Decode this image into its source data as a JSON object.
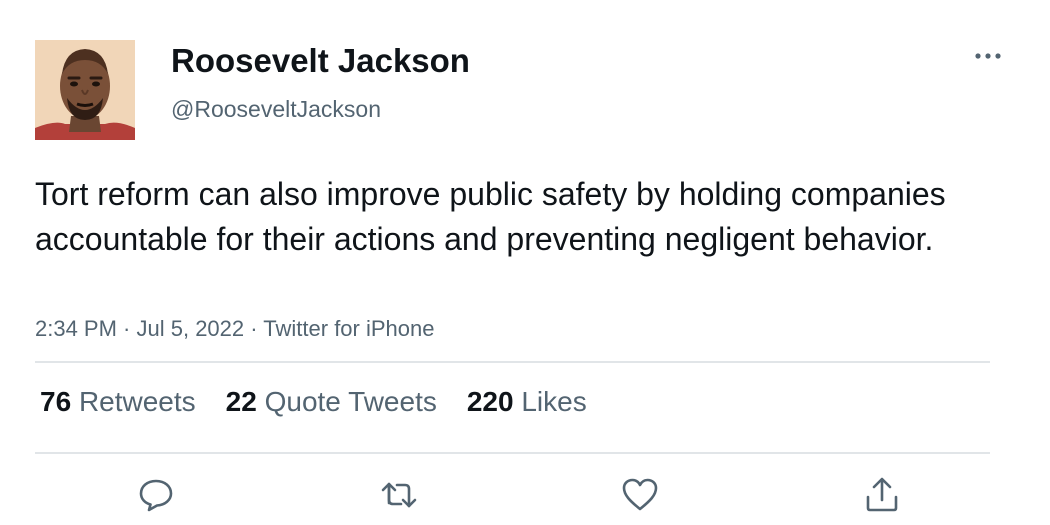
{
  "author": {
    "display_name": "Roosevelt Jackson",
    "handle": "@RooseveltJackson",
    "avatar_icon": "profile-photo"
  },
  "tweet": {
    "text": "Tort reform can also improve public safety by holding companies accountable for their actions and preventing negligent behavior.",
    "time": "2:34 PM",
    "date": "Jul 5, 2022",
    "source": "Twitter for iPhone",
    "separator": " · "
  },
  "stats": {
    "retweets_count": "76",
    "retweets_label": "Retweets",
    "quotes_count": "22",
    "quotes_label": "Quote Tweets",
    "likes_count": "220",
    "likes_label": "Likes"
  },
  "actions": {
    "reply_icon": "reply-icon",
    "retweet_icon": "retweet-icon",
    "like_icon": "heart-icon",
    "share_icon": "share-icon",
    "more_icon": "more-icon"
  },
  "colors": {
    "text_primary": "#0f1419",
    "text_secondary": "#536471",
    "icon": "#536471",
    "divider": "#e1e5e8"
  }
}
